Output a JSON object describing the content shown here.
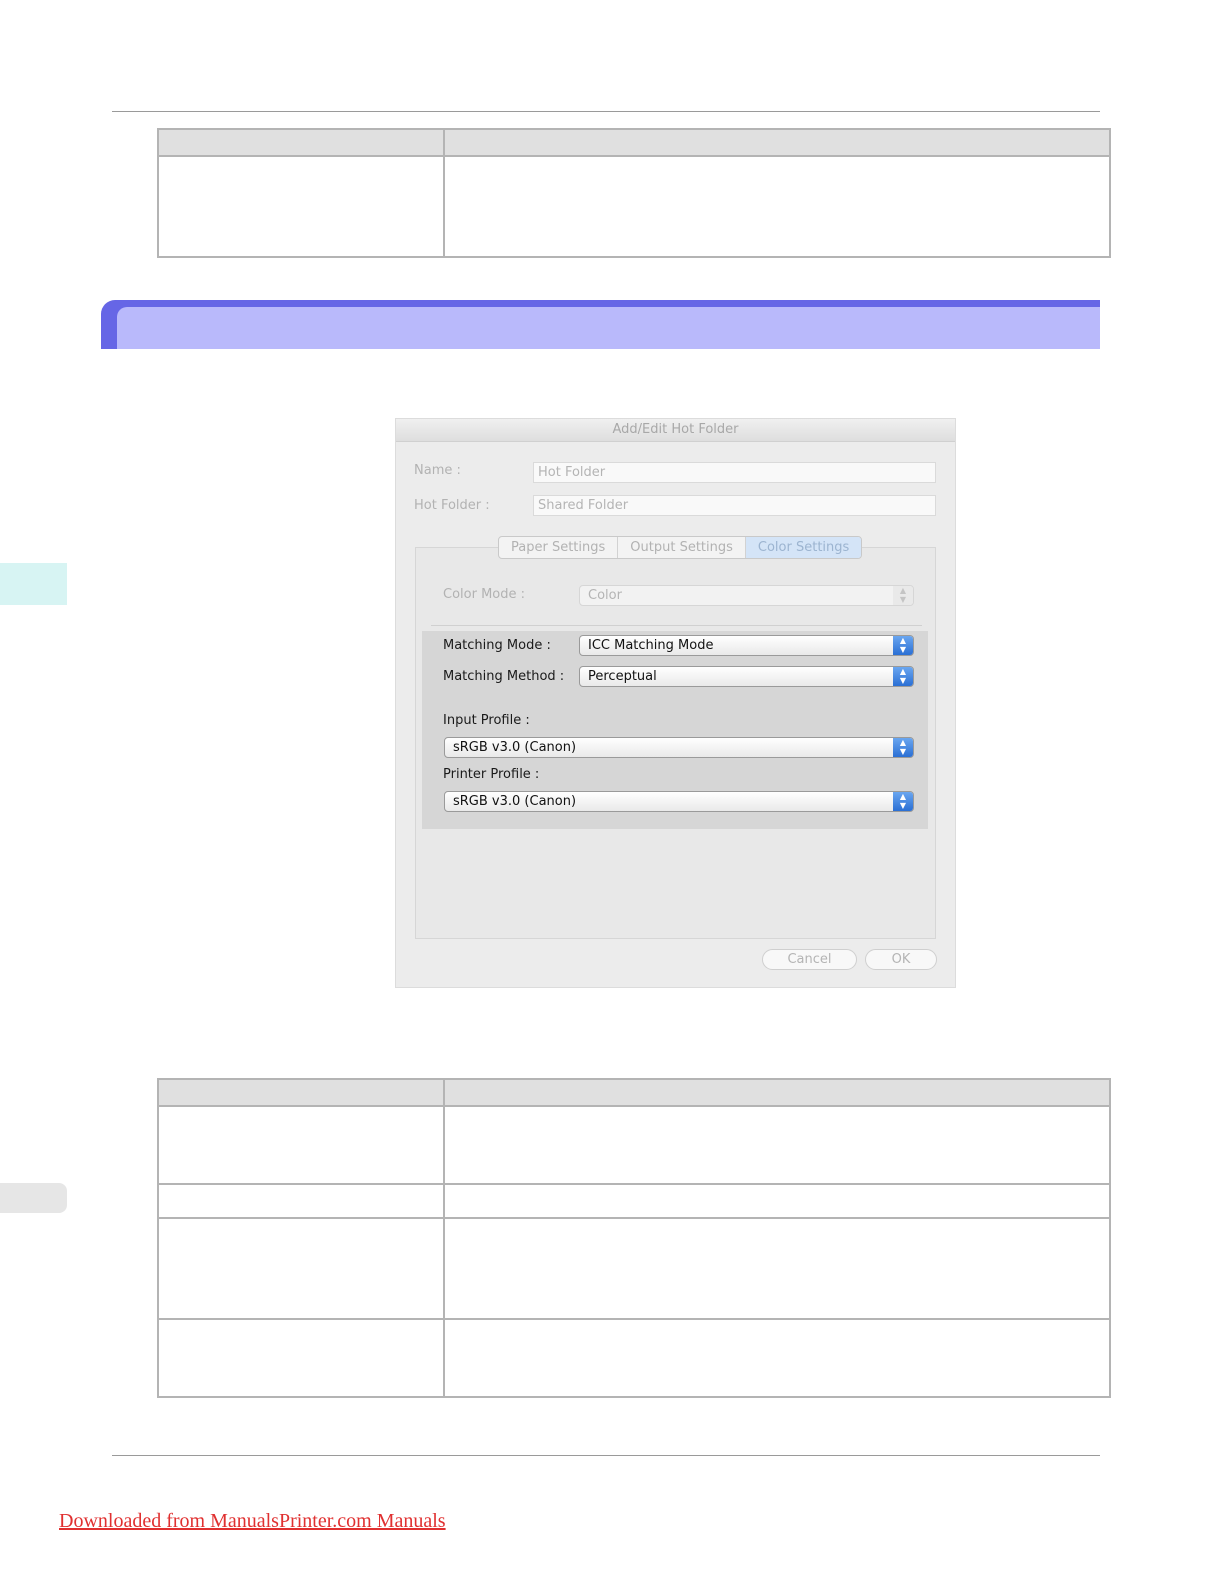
{
  "dialog": {
    "title": "Add/Edit Hot Folder",
    "name_label": "Name :",
    "name_value": "Hot Folder",
    "hot_folder_label": "Hot Folder :",
    "hot_folder_value": "Shared Folder",
    "tabs": [
      {
        "label": "Paper Settings",
        "active": false
      },
      {
        "label": "Output Settings",
        "active": false
      },
      {
        "label": "Color Settings",
        "active": true
      }
    ],
    "color_mode_label": "Color Mode :",
    "color_mode_value": "Color",
    "matching_mode_label": "Matching Mode :",
    "matching_mode_value": "ICC Matching Mode",
    "matching_method_label": "Matching Method :",
    "matching_method_value": "Perceptual",
    "input_profile_label": "Input Profile :",
    "input_profile_value": "sRGB v3.0 (Canon)",
    "printer_profile_label": "Printer Profile :",
    "printer_profile_value": "sRGB v3.0 (Canon)",
    "cancel_label": "Cancel",
    "ok_label": "OK"
  },
  "footer": {
    "link_text": "Downloaded from ManualsPrinter.com Manuals"
  },
  "colors": {
    "section_band": "#6666e6",
    "section_band_inner": "#b9b9fb",
    "side_tab": "#d7f4f3",
    "footer_link": "#e03030"
  }
}
